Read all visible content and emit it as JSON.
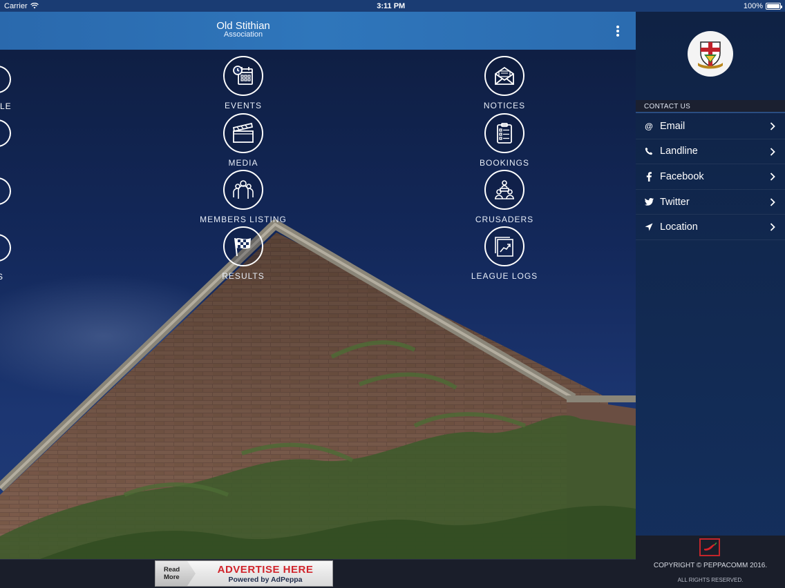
{
  "status_bar": {
    "carrier": "Carrier",
    "time": "3:11 PM",
    "battery": "100%"
  },
  "header": {
    "title": "Old Stithian",
    "subtitle": "Association"
  },
  "tiles": [
    {
      "label": "EVENTS",
      "icon": "calendar-icon"
    },
    {
      "label": "NOTICES",
      "icon": "envelope-icon"
    },
    {
      "label": "MEDIA",
      "icon": "clapperboard-icon"
    },
    {
      "label": "BOOKINGS",
      "icon": "clipboard-icon"
    },
    {
      "label": "MEMBERS LISTING",
      "icon": "people-icon"
    },
    {
      "label": "CRUSADERS",
      "icon": "team-icon"
    },
    {
      "label": "RESULTS",
      "icon": "checkered-flag-icon"
    },
    {
      "label": "LEAGUE LOGS",
      "icon": "chart-icon"
    }
  ],
  "edge_labels": [
    "LE",
    "S"
  ],
  "ad": {
    "read_more": "Read More",
    "headline": "ADVERTISE HERE",
    "powered": "Powered by AdPeppa"
  },
  "side_panel": {
    "section_title": "CONTACT US",
    "items": [
      {
        "label": "Email",
        "icon": "at-icon"
      },
      {
        "label": "Landline",
        "icon": "phone-icon"
      },
      {
        "label": "Facebook",
        "icon": "facebook-icon"
      },
      {
        "label": "Twitter",
        "icon": "twitter-icon"
      },
      {
        "label": "Location",
        "icon": "location-arrow-icon"
      }
    ],
    "footer_copyright": "COPYRIGHT © PEPPACOMM 2016.",
    "footer_rights": "ALL RIGHTS RESERVED."
  },
  "colors": {
    "header_blue": "#2f76bb",
    "panel_navy": "#0f2244",
    "ad_red": "#d1232a"
  }
}
